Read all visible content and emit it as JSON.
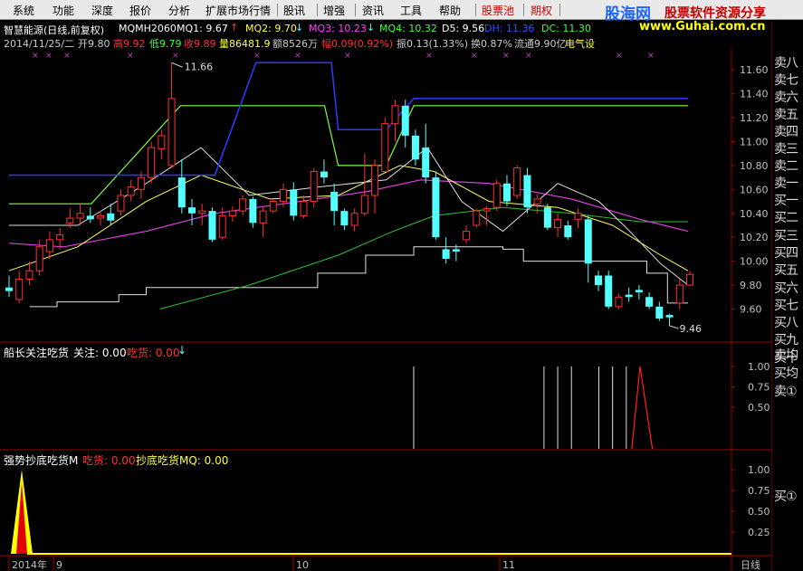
{
  "menu": {
    "items": [
      "系统",
      "功能",
      "深度",
      "报价",
      "分析",
      "扩展市场行情",
      "股讯",
      "增强",
      "资讯",
      "工具",
      "帮助",
      "股票池",
      "期权"
    ]
  },
  "logo": {
    "brand": "股海网",
    "slogan": "股票软件资源分享",
    "url": "www.Guhai.com.cn"
  },
  "info": {
    "line1": {
      "name": "智慧能源(日线,前复权)",
      "indicator": "MQMH2060",
      "mq1": "MQ1: 9.67",
      "mq2": "MQ2: 9.70",
      "mq3": "MQ3: 10.23",
      "mq4": "MQ4: 10.32",
      "d5": "D5: 9.56",
      "dh": "DH: 11.36",
      "dc": "DC: 11.30"
    },
    "line2": {
      "date": "2014/11/25/二",
      "open": "开9.80",
      "high": "高9.92",
      "low": "低9.79",
      "close": "收9.89",
      "volume": "量86481.9",
      "amount": "额8526万",
      "change": "幅0.09(0.92%)",
      "amplitude": "振0.13(1.33%)",
      "turnover": "换0.87%",
      "float": "流通9.90亿",
      "sector": "电气设"
    }
  },
  "panels": {
    "p2": {
      "title": "船长关注吃货",
      "guanzhu": "关注: 0.00",
      "chihuo": "吃货: 0.00"
    },
    "p3": {
      "title": "强势抄底吃货M",
      "chihuo": "吃货: 0.00",
      "chaodi": "抄底吃货MQ: 0.00"
    }
  },
  "annotations": {
    "high": "11.66",
    "low": "9.46"
  },
  "axes": {
    "price_ticks": [
      "11.60",
      "11.40",
      "11.20",
      "11.00",
      "10.80",
      "10.60",
      "10.40",
      "10.20",
      "10.00",
      "9.80",
      "9.60"
    ],
    "p2_ticks": [
      "1.00",
      "0.75",
      "0.50"
    ],
    "p3_ticks": [
      "1.00",
      "0.75",
      "0.50",
      "0.25"
    ],
    "x_labels": [
      "2014年",
      "9",
      "10",
      "11"
    ],
    "period": "日线"
  },
  "order_book": {
    "sell": [
      "卖八",
      "卖七",
      "卖六",
      "卖五",
      "卖四",
      "卖三",
      "卖二",
      "卖一"
    ],
    "buy": [
      "买一",
      "买二",
      "买三",
      "买四",
      "买五",
      "买六",
      "买七",
      "买八",
      "买九",
      "买十"
    ],
    "extra": [
      "卖均",
      "买均",
      "卖①"
    ],
    "extra2": [
      "买①"
    ]
  },
  "colors": {
    "up": "#ff3030",
    "down": "#54ffff",
    "mq_blue": "#2b3cff",
    "mq_green": "#7cff3c",
    "ma_yellow": "#ffff66",
    "ma_white": "#e0e0e0",
    "ma_magenta": "#e040e0",
    "ma_green": "#30c030"
  },
  "candles": [
    [
      9.78,
      9.88,
      9.7,
      9.75
    ],
    [
      9.68,
      9.92,
      9.65,
      9.85
    ],
    [
      9.85,
      10.0,
      9.8,
      9.92
    ],
    [
      9.92,
      10.18,
      9.88,
      10.12
    ],
    [
      10.08,
      10.25,
      10.02,
      10.18
    ],
    [
      10.18,
      10.28,
      10.1,
      10.22
    ],
    [
      10.32,
      10.44,
      10.28,
      10.36
    ],
    [
      10.36,
      10.48,
      10.3,
      10.4
    ],
    [
      10.38,
      10.45,
      10.32,
      10.35
    ],
    [
      10.36,
      10.42,
      10.3,
      10.38
    ],
    [
      10.4,
      10.48,
      10.3,
      10.34
    ],
    [
      10.42,
      10.6,
      10.38,
      10.55
    ],
    [
      10.55,
      10.68,
      10.5,
      10.62
    ],
    [
      10.6,
      10.75,
      10.52,
      10.7
    ],
    [
      10.7,
      11.0,
      10.65,
      10.95
    ],
    [
      10.94,
      11.1,
      10.85,
      11.05
    ],
    [
      10.8,
      11.66,
      10.78,
      11.36
    ],
    [
      10.7,
      10.85,
      10.4,
      10.45
    ],
    [
      10.45,
      10.52,
      10.3,
      10.4
    ],
    [
      10.4,
      10.48,
      10.3,
      10.42
    ],
    [
      10.42,
      10.45,
      10.16,
      10.18
    ],
    [
      10.2,
      10.45,
      10.18,
      10.38
    ],
    [
      10.38,
      10.46,
      10.33,
      10.42
    ],
    [
      10.42,
      10.55,
      10.38,
      10.52
    ],
    [
      10.52,
      10.54,
      10.28,
      10.32
    ],
    [
      10.32,
      10.45,
      10.2,
      10.42
    ],
    [
      10.42,
      10.52,
      10.4,
      10.5
    ],
    [
      10.5,
      10.65,
      10.45,
      10.6
    ],
    [
      10.6,
      10.66,
      10.34,
      10.38
    ],
    [
      10.38,
      10.55,
      10.36,
      10.5
    ],
    [
      10.5,
      10.78,
      10.45,
      10.75
    ],
    [
      10.75,
      10.85,
      10.65,
      10.7
    ],
    [
      10.58,
      10.65,
      10.3,
      10.42
    ],
    [
      10.42,
      10.44,
      10.26,
      10.3
    ],
    [
      10.3,
      10.44,
      10.25,
      10.4
    ],
    [
      10.4,
      10.9,
      10.38,
      10.55
    ],
    [
      10.55,
      10.85,
      10.4,
      10.8
    ],
    [
      10.75,
      11.2,
      10.75,
      11.15
    ],
    [
      11.15,
      11.35,
      11.0,
      11.3
    ],
    [
      11.3,
      11.35,
      10.95,
      11.05
    ],
    [
      11.05,
      11.1,
      10.8,
      10.85
    ],
    [
      10.95,
      11.15,
      10.65,
      10.7
    ],
    [
      10.7,
      10.75,
      10.18,
      10.2
    ],
    [
      10.1,
      10.2,
      9.98,
      10.02
    ],
    [
      10.1,
      10.14,
      10.0,
      10.08
    ],
    [
      10.18,
      10.3,
      10.15,
      10.25
    ],
    [
      10.3,
      10.44,
      10.28,
      10.42
    ],
    [
      10.42,
      10.46,
      10.3,
      10.44
    ],
    [
      10.45,
      10.68,
      10.42,
      10.65
    ],
    [
      10.65,
      10.72,
      10.46,
      10.5
    ],
    [
      10.55,
      10.8,
      10.52,
      10.78
    ],
    [
      10.72,
      10.78,
      10.4,
      10.45
    ],
    [
      10.48,
      10.56,
      10.4,
      10.52
    ],
    [
      10.45,
      10.48,
      10.26,
      10.28
    ],
    [
      10.28,
      10.4,
      10.2,
      10.35
    ],
    [
      10.3,
      10.34,
      10.18,
      10.2
    ],
    [
      10.35,
      10.44,
      10.28,
      10.4
    ],
    [
      10.35,
      10.38,
      9.82,
      9.98
    ],
    [
      9.88,
      9.92,
      9.75,
      9.8
    ],
    [
      9.88,
      9.92,
      9.6,
      9.62
    ],
    [
      9.62,
      9.73,
      9.6,
      9.7
    ],
    [
      9.72,
      9.78,
      9.66,
      9.7
    ],
    [
      9.76,
      9.8,
      9.68,
      9.74
    ],
    [
      9.7,
      9.74,
      9.6,
      9.62
    ],
    [
      9.62,
      9.66,
      9.5,
      9.52
    ],
    [
      9.55,
      9.56,
      9.46,
      9.53
    ],
    [
      9.65,
      9.85,
      9.6,
      9.8
    ],
    [
      9.8,
      9.92,
      9.79,
      9.89
    ]
  ],
  "mq_upper": [
    [
      0,
      10.72
    ],
    [
      30,
      10.72
    ],
    [
      36,
      11.66
    ],
    [
      47,
      11.66
    ],
    [
      48,
      11.1
    ],
    [
      55,
      11.1
    ],
    [
      59,
      11.36
    ],
    [
      99,
      11.36
    ]
  ],
  "mq_lower": [
    [
      0,
      10.48
    ],
    [
      12,
      10.48
    ],
    [
      25,
      11.3
    ],
    [
      46,
      11.3
    ],
    [
      48,
      10.8
    ],
    [
      55,
      10.8
    ],
    [
      59,
      11.3
    ],
    [
      99,
      11.3
    ]
  ],
  "ma_white": [
    [
      0,
      10.3
    ],
    [
      10,
      10.3
    ],
    [
      20,
      10.65
    ],
    [
      28,
      10.95
    ],
    [
      35,
      10.55
    ],
    [
      45,
      10.62
    ],
    [
      55,
      10.68
    ],
    [
      61,
      10.95
    ],
    [
      66,
      10.5
    ],
    [
      72,
      10.25
    ],
    [
      80,
      10.65
    ],
    [
      86,
      10.5
    ],
    [
      90,
      10.28
    ],
    [
      95,
      9.98
    ],
    [
      99,
      9.8
    ]
  ],
  "ma_yellow": [
    [
      0,
      9.92
    ],
    [
      10,
      10.12
    ],
    [
      20,
      10.5
    ],
    [
      28,
      10.72
    ],
    [
      38,
      10.52
    ],
    [
      48,
      10.55
    ],
    [
      57,
      10.8
    ],
    [
      62,
      10.75
    ],
    [
      70,
      10.5
    ],
    [
      80,
      10.45
    ],
    [
      88,
      10.3
    ],
    [
      95,
      10.05
    ],
    [
      99,
      9.92
    ]
  ],
  "ma_magenta": [
    [
      0,
      10.15
    ],
    [
      8,
      10.12
    ],
    [
      20,
      10.25
    ],
    [
      30,
      10.4
    ],
    [
      40,
      10.48
    ],
    [
      52,
      10.58
    ],
    [
      60,
      10.68
    ],
    [
      70,
      10.65
    ],
    [
      82,
      10.52
    ],
    [
      92,
      10.35
    ],
    [
      99,
      10.25
    ]
  ],
  "ma_green": [
    [
      22,
      9.6
    ],
    [
      35,
      9.8
    ],
    [
      48,
      10.05
    ],
    [
      56,
      10.25
    ],
    [
      62,
      10.38
    ],
    [
      72,
      10.45
    ],
    [
      82,
      10.4
    ],
    [
      92,
      10.33
    ],
    [
      99,
      10.33
    ]
  ],
  "stair_white": [
    [
      3,
      9.62
    ],
    [
      7,
      9.62
    ],
    [
      7,
      9.66
    ],
    [
      16,
      9.66
    ],
    [
      16,
      9.72
    ],
    [
      20,
      9.72
    ],
    [
      20,
      9.78
    ],
    [
      45,
      9.78
    ],
    [
      45,
      9.9
    ],
    [
      52,
      9.9
    ],
    [
      52,
      10.05
    ],
    [
      59,
      10.05
    ],
    [
      59,
      10.12
    ],
    [
      72,
      10.12
    ],
    [
      72,
      10.1
    ],
    [
      75,
      10.1
    ],
    [
      75,
      10.0
    ],
    [
      93,
      10.0
    ],
    [
      93,
      9.9
    ],
    [
      96,
      9.9
    ],
    [
      96,
      9.65
    ],
    [
      99,
      9.65
    ]
  ],
  "p2_spikes": [
    59,
    78,
    80,
    82,
    86,
    88,
    90
  ],
  "p2_peak": [
    92,
    1.0
  ],
  "p3_peak": [
    3,
    1.0
  ]
}
